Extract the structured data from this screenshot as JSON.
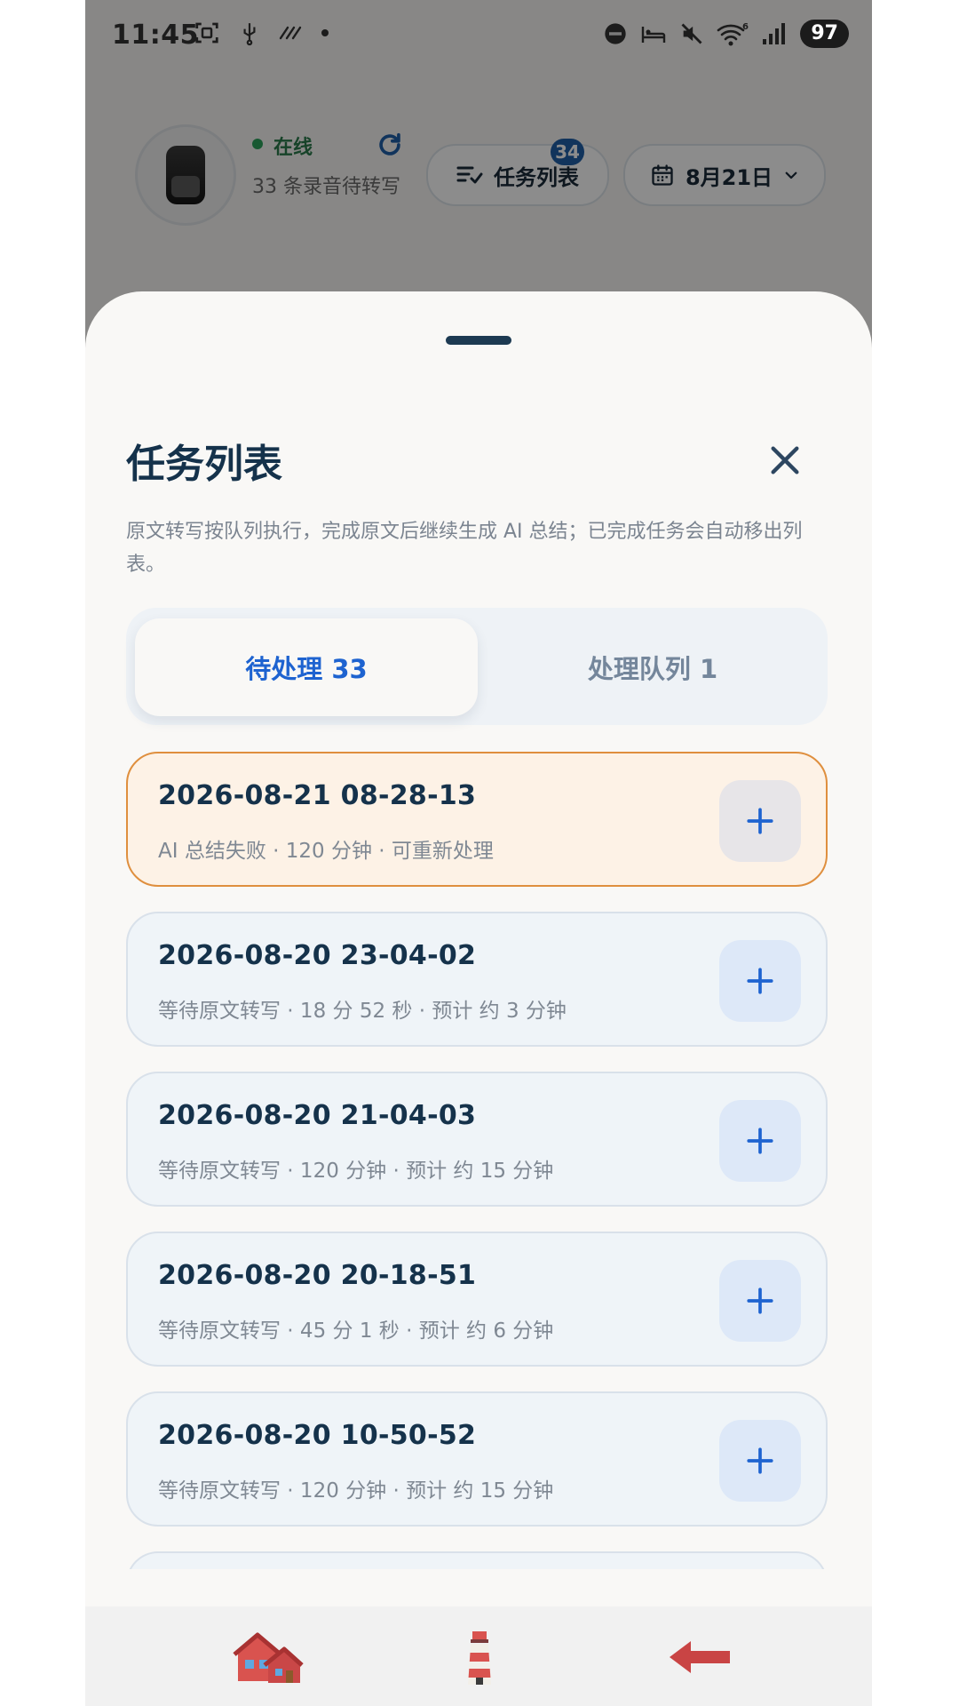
{
  "status_bar": {
    "time": "11:45",
    "battery": "97",
    "wifi_label": "6"
  },
  "header": {
    "status": "在线",
    "pending": "33 条录音待转写",
    "task_chip_label": "任务列表",
    "task_badge": "34",
    "date_chip_label": "8月21日"
  },
  "sheet": {
    "title": "任务列表",
    "description": "原文转写按队列执行，完成原文后继续生成 AI 总结；已完成任务会自动移出列表。",
    "tabs": [
      {
        "label": "待处理 33",
        "active": true
      },
      {
        "label": "处理队列 1",
        "active": false
      }
    ],
    "items": [
      {
        "title": "2026-08-21 08-28-13",
        "subtitle": "AI 总结失败 · 120 分钟 · 可重新处理",
        "state": "warn"
      },
      {
        "title": "2026-08-20 23-04-02",
        "subtitle": "等待原文转写 · 18 分 52 秒 · 预计 约 3 分钟",
        "state": "normal"
      },
      {
        "title": "2026-08-20 21-04-03",
        "subtitle": "等待原文转写 · 120 分钟 · 预计 约 15 分钟",
        "state": "normal"
      },
      {
        "title": "2026-08-20 20-18-51",
        "subtitle": "等待原文转写 · 45 分 1 秒 · 预计 约 6 分钟",
        "state": "normal"
      },
      {
        "title": "2026-08-20 10-50-52",
        "subtitle": "等待原文转写 · 120 分钟 · 预计 约 15 分钟",
        "state": "normal"
      }
    ]
  },
  "colors": {
    "accent": "#1e63d0",
    "warn_border": "#df8f3e",
    "warn_bg": "#fdf2e6",
    "title": "#15324b"
  },
  "icons": {
    "close": "close-icon",
    "add": "plus-icon",
    "refresh": "refresh-icon",
    "calendar": "calendar-icon",
    "nav": [
      "houses-icon",
      "lighthouse-icon",
      "left-arrow-icon"
    ]
  }
}
